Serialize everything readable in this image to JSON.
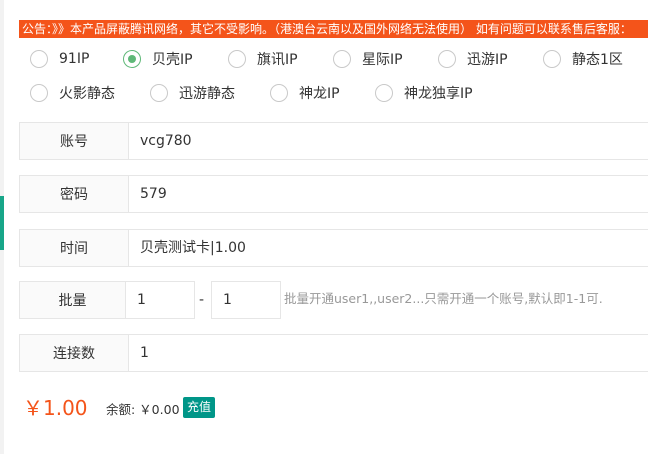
{
  "notice": "公告：》》本产品屏蔽腾讯网络，其它不受影响。（港澳台云南以及国外网络无法使用） 如有问题可以联系售后客服：",
  "lines": {
    "row1": [
      {
        "label": "91IP",
        "checked": false
      },
      {
        "label": "贝壳IP",
        "checked": true
      },
      {
        "label": "旗讯IP",
        "checked": false
      },
      {
        "label": "星际IP",
        "checked": false
      },
      {
        "label": "迅游IP",
        "checked": false
      },
      {
        "label": "静态1区",
        "checked": false
      }
    ],
    "row2": [
      {
        "label": "火影静态",
        "checked": false
      },
      {
        "label": "迅游静态",
        "checked": false
      },
      {
        "label": "神龙IP",
        "checked": false
      },
      {
        "label": "神龙独享IP",
        "checked": false
      }
    ]
  },
  "form": {
    "account": {
      "label": "账号",
      "value": "vcg780"
    },
    "password": {
      "label": "密码",
      "value": "579"
    },
    "time": {
      "label": "时间",
      "value": "贝壳测试卡|1.00"
    },
    "batch": {
      "label": "批量",
      "from": "1",
      "dash": "-",
      "to": "1",
      "hint": "批量开通user1,,user2...只需开通一个账号,默认即1-1可."
    },
    "connections": {
      "label": "连接数",
      "value": "1"
    }
  },
  "footer": {
    "price": "￥1.00",
    "balance": "余额: ￥0.00",
    "recharge": "充值"
  },
  "colors": {
    "notice_bg": "#f4541a",
    "radio_checked": "#5fb878",
    "recharge_bg": "#009688",
    "price": "#f4541a"
  }
}
